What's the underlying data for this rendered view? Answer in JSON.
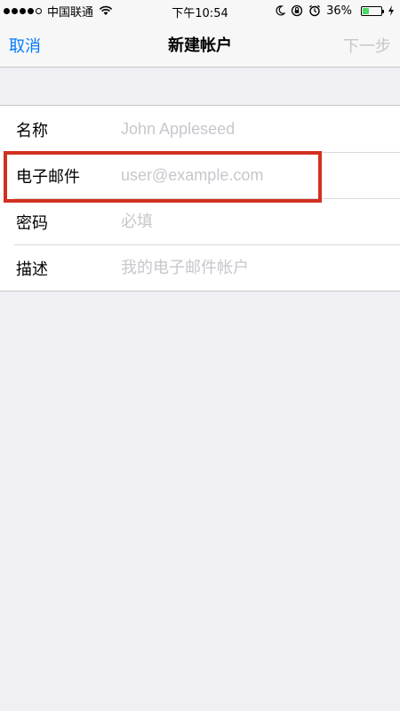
{
  "status_bar": {
    "carrier": "中国联通",
    "time": "下午10:54",
    "battery_percent": "36%",
    "battery_level": 0.36,
    "battery_color": "#4cd964",
    "icons": [
      "signal-dots",
      "wifi-icon",
      "moon-icon",
      "rotation-lock-icon",
      "alarm-icon",
      "battery-icon",
      "charging-bolt-icon"
    ]
  },
  "nav": {
    "cancel_label": "取消",
    "title": "新建帐户",
    "next_label": "下一步",
    "accent_color": "#007aff",
    "disabled_color": "#c7c7cc"
  },
  "form": {
    "fields": [
      {
        "label": "名称",
        "placeholder": "John Appleseed",
        "value": ""
      },
      {
        "label": "电子邮件",
        "placeholder": "user@example.com",
        "value": ""
      },
      {
        "label": "密码",
        "placeholder": "必填",
        "value": ""
      },
      {
        "label": "描述",
        "placeholder": "我的电子邮件帐户",
        "value": ""
      }
    ]
  },
  "annotation": {
    "highlight_color": "#d0311f",
    "highlighted_field": "电子邮件"
  }
}
